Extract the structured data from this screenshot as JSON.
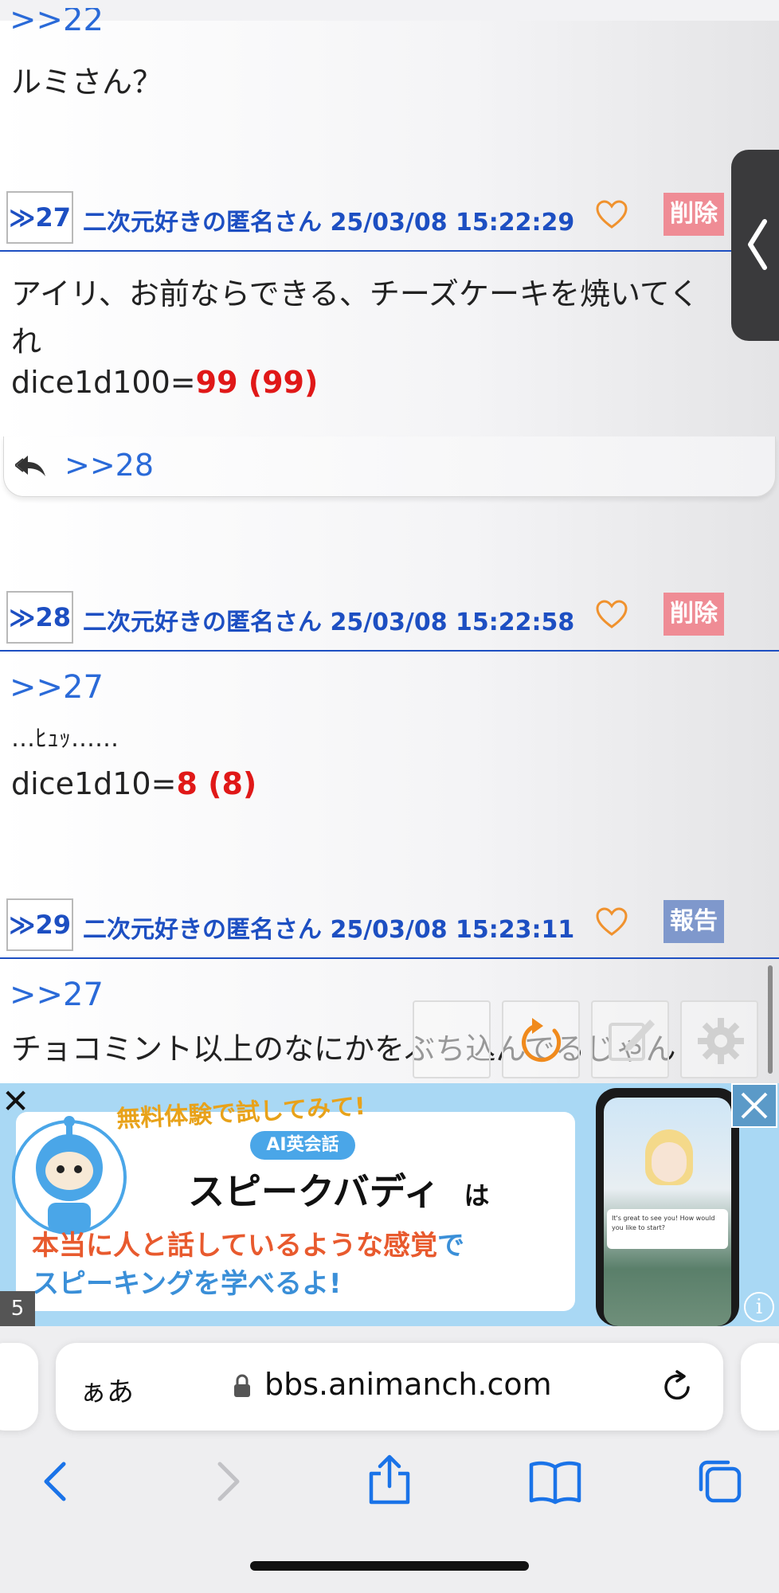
{
  "posts": [
    {
      "partial_anchor": ">>22",
      "text": "ルミさん？"
    },
    {
      "number": "≫27",
      "author": "二次元好きの匿名さん",
      "datetime": "25/03/08 15:22:29",
      "action_label": "削除",
      "action_color": "#ef8c95",
      "body_line1": "アイリ、お前ならできる、チーズケーキを焼いてく",
      "body_line2": "れ",
      "dice_label": "dice1d100=",
      "dice_result": "99 (99)",
      "reply_link": ">>28"
    },
    {
      "number": "≫28",
      "author": "二次元好きの匿名さん",
      "datetime": "25/03/08 15:22:58",
      "action_label": "削除",
      "action_color": "#ef8c95",
      "anchor": ">>27",
      "body_line1": "…ﾋｭｯ……",
      "dice_label": "dice1d10=",
      "dice_result": "8 (8)"
    },
    {
      "number": "≫29",
      "author": "二次元好きの匿名さん",
      "datetime": "25/03/08 15:23:11",
      "action_label": "報告",
      "action_color": "#7f98cc",
      "anchor": ">>27",
      "body_line1": "チョコミント以上のなにかをぶち込んでるじゃん"
    }
  ],
  "colors": {
    "link_blue": "#2a6ad8",
    "header_blue": "#1d4fc2",
    "dice_red": "#e01818",
    "heart_orange": "#f0922e"
  },
  "toolbar_icons": [
    "blank-tool-icon",
    "reload-icon",
    "edit-icon",
    "settings-icon"
  ],
  "ad": {
    "close_mark": "✕",
    "headline": "無料体験で試してみて!",
    "tag": "AI英会話",
    "brand": "スピークバディ",
    "brand_suffix": "は",
    "line1_part1": "本当に人と話しているような感覚",
    "line1_part2": "で",
    "line2": "スピーキングを学べるよ!",
    "phone_caption": "It's great to see you! How would you like to start?",
    "counter": "5",
    "info": "i"
  },
  "browser": {
    "text_size_label": "ぁあ",
    "url": "bbs.animanch.com",
    "nav_icons": [
      "back-icon",
      "forward-icon",
      "share-icon",
      "bookmarks-icon",
      "tabs-icon"
    ]
  }
}
